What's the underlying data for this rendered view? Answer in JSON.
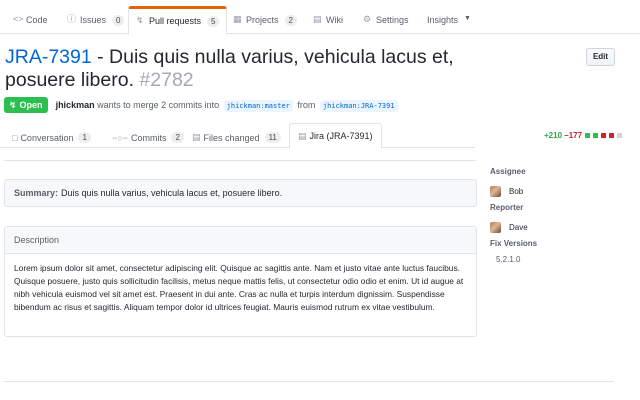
{
  "repo_nav": {
    "tabs": [
      {
        "label": "Code",
        "icon": "code-icon",
        "counter": ""
      },
      {
        "label": "Issues",
        "icon": "issue-icon",
        "counter": "0"
      },
      {
        "label": "Pull requests",
        "icon": "pull-request-icon",
        "counter": "5"
      },
      {
        "label": "Projects",
        "icon": "project-icon",
        "counter": "2"
      },
      {
        "label": "Wiki",
        "icon": "wiki-icon",
        "counter": ""
      },
      {
        "label": "Settings",
        "icon": "gear-icon",
        "counter": ""
      },
      {
        "label": "Insights",
        "icon": "chevron-down-icon",
        "counter": ""
      }
    ],
    "selected": "Pull requests"
  },
  "header": {
    "jira_key": "JRA-7391",
    "title_text": " - Duis quis nulla varius, vehicula lacus et, posuere libero.",
    "number": "#2782",
    "edit_label": "Edit"
  },
  "meta": {
    "state": "Open",
    "author": "jhickman",
    "text_before": "wants to merge 2 commits into",
    "base_branch": "jhickman:master",
    "text_from": "from",
    "head_branch": "jhickman:JRA-7391"
  },
  "pr_tabs": [
    {
      "label": "Conversation",
      "icon": "comment-icon",
      "counter": "1"
    },
    {
      "label": "Commits",
      "icon": "commit-icon",
      "counter": "2"
    },
    {
      "label": "Files changed",
      "icon": "file-diff-icon",
      "counter": "11"
    },
    {
      "label": "Jira (JRA-7391)",
      "icon": "jira-card-icon",
      "counter": ""
    }
  ],
  "diffstat": {
    "additions": "+210",
    "deletions": "−177"
  },
  "summary": {
    "label": "Summary:",
    "text": "Duis quis nulla varius, vehicula lacus et, posuere libero."
  },
  "description": {
    "heading": "Description",
    "text": "Lorem ipsum dolor sit amet, consectetur adipiscing elit. Quisque ac sagittis ante. Nam et justo vitae ante luctus faucibus. Quisque posuere, justo quis sollicitudin facilisis, metus neque mattis felis, ut consectetur odio odio et enim. Ut id augue at nibh vehicula euismod vel sit amet est. Praesent in dui ante. Cras ac nulla et turpis interdum dignissim. Suspendisse bibendum ac risus et sagittis. Aliquam tempor dolor id ultrices feugiat. Mauris euismod rutrum ex vitae vestibulum."
  },
  "sidebar": {
    "assignee_label": "Assignee",
    "assignee": "Bob",
    "reporter_label": "Reporter",
    "reporter": "Dave",
    "fix_versions_label": "Fix Versions",
    "fix_version": "5.2.1.0"
  },
  "colors": {
    "accent": "#0366d6",
    "open_green": "#2cbe4e",
    "selected_tab_border": "#e36209",
    "add": "#28a745",
    "del": "#cb2431"
  }
}
